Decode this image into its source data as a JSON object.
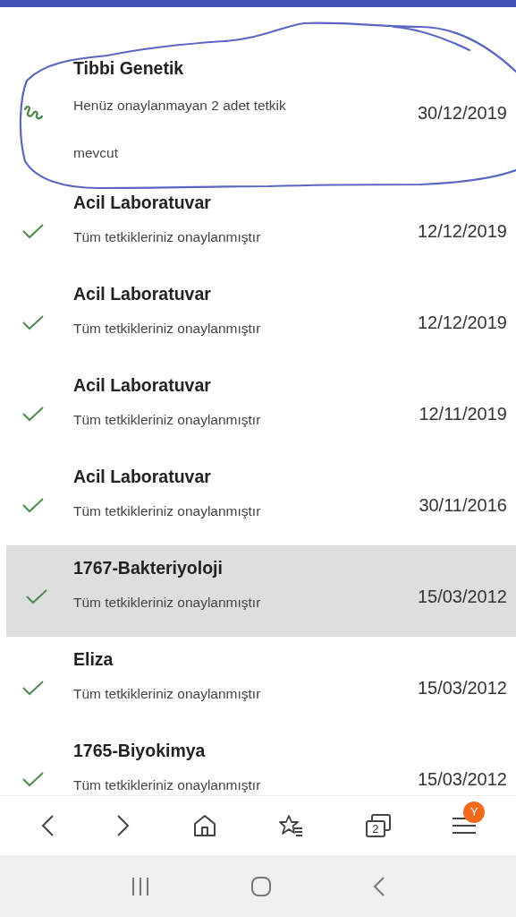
{
  "results": [
    {
      "kind": "pending",
      "title": "Tibbi Genetik",
      "status": "Henüz onaylanmayan 2 adet tetkik mevcut",
      "date": "30/12/2019",
      "selected": false
    },
    {
      "kind": "approved",
      "title": "Acil Laboratuvar",
      "status": "Tüm tetkikleriniz onaylanmıştır",
      "date": "12/12/2019",
      "selected": false
    },
    {
      "kind": "approved",
      "title": "Acil Laboratuvar",
      "status": "Tüm tetkikleriniz onaylanmıştır",
      "date": "12/12/2019",
      "selected": false
    },
    {
      "kind": "approved",
      "title": "Acil Laboratuvar",
      "status": "Tüm tetkikleriniz onaylanmıştır",
      "date": "12/11/2019",
      "selected": false
    },
    {
      "kind": "approved",
      "title": "Acil Laboratuvar",
      "status": "Tüm tetkikleriniz onaylanmıştır",
      "date": "30/11/2016",
      "selected": false
    },
    {
      "kind": "approved",
      "title": "1767-Bakteriyoloji",
      "status": "Tüm tetkikleriniz onaylanmıştır",
      "date": "15/03/2012",
      "selected": true
    },
    {
      "kind": "approved",
      "title": "Eliza",
      "status": "Tüm tetkikleriniz onaylanmıştır",
      "date": "15/03/2012",
      "selected": false
    },
    {
      "kind": "approved",
      "title": "1765-Biyokimya",
      "status": "Tüm tetkikleriniz onaylanmıştır",
      "date": "15/03/2012",
      "selected": false
    }
  ],
  "browser_bar": {
    "tab_count": "2",
    "menu_badge": "Y"
  }
}
